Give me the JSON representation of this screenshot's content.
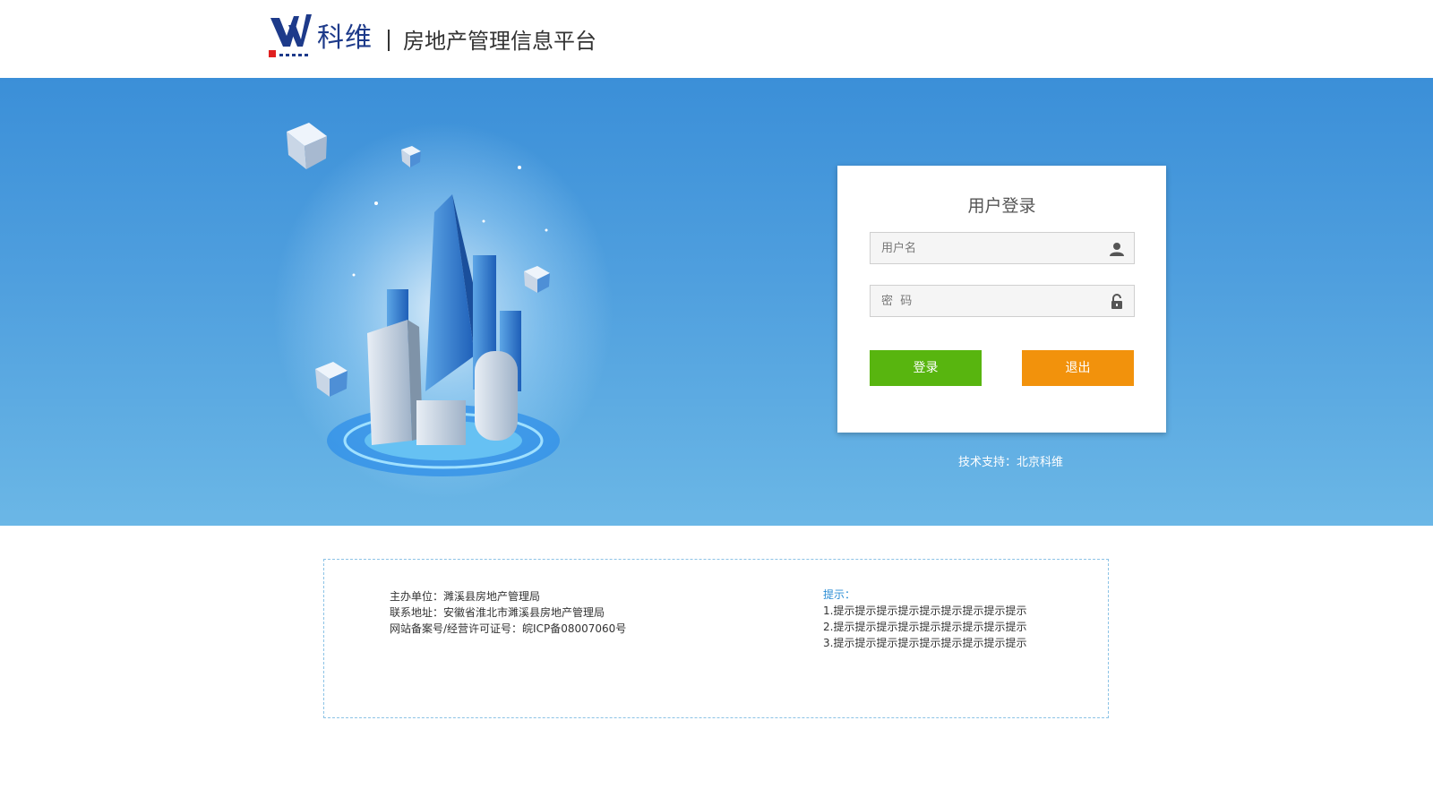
{
  "header": {
    "brand_name": "科维",
    "platform_title": "房地产管理信息平台"
  },
  "login": {
    "title": "用户登录",
    "username_placeholder": "用户名",
    "password_placeholder": "密  码",
    "login_label": "登录",
    "exit_label": "退出",
    "username_icon": "user-icon",
    "password_icon": "lock-icon"
  },
  "support_text": "技术支持：北京科维",
  "footer": {
    "host_unit": "主办单位：濉溪县房地产管理局",
    "address": "联系地址：安徽省淮北市濉溪县房地产管理局",
    "icp": "网站备案号/经营许可证号：皖ICP备08007060号",
    "tips_title": "提示：",
    "tips": [
      "1.提示提示提示提示提示提示提示提示提示",
      "2.提示提示提示提示提示提示提示提示提示",
      "3.提示提示提示提示提示提示提示提示提示"
    ]
  },
  "colors": {
    "banner_top": "#3b8fd8",
    "banner_bottom": "#6bb7e6",
    "login_button": "#58b50f",
    "exit_button": "#f2920c",
    "tips_title": "#2a8cd4"
  }
}
